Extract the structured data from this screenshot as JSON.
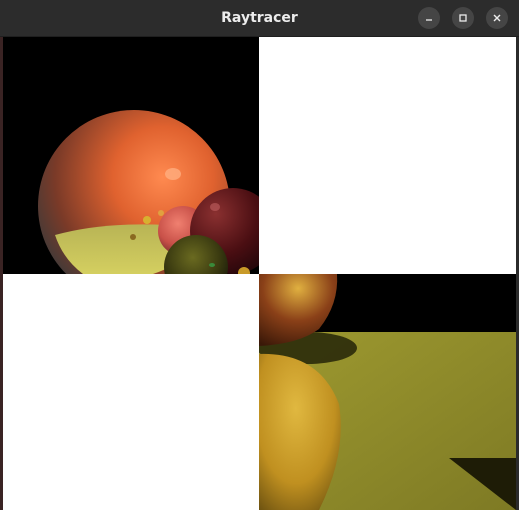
{
  "window": {
    "title": "Raytracer",
    "controls": {
      "minimize_icon": "minimize-icon",
      "maximize_icon": "maximize-icon",
      "close_icon": "close-icon"
    }
  },
  "render": {
    "tiles": [
      {
        "position": "top-left",
        "state": "rendered"
      },
      {
        "position": "top-right",
        "state": "pending"
      },
      {
        "position": "bottom-left",
        "state": "pending"
      },
      {
        "position": "bottom-right",
        "state": "rendered"
      }
    ],
    "colors": {
      "pending_tile": "#ffffff",
      "background": "#000000",
      "floor": "#a9a335",
      "orange_sphere": "#e8683c",
      "dark_red_sphere": "#5a0f12",
      "gold_sphere": "#c8a020"
    }
  }
}
